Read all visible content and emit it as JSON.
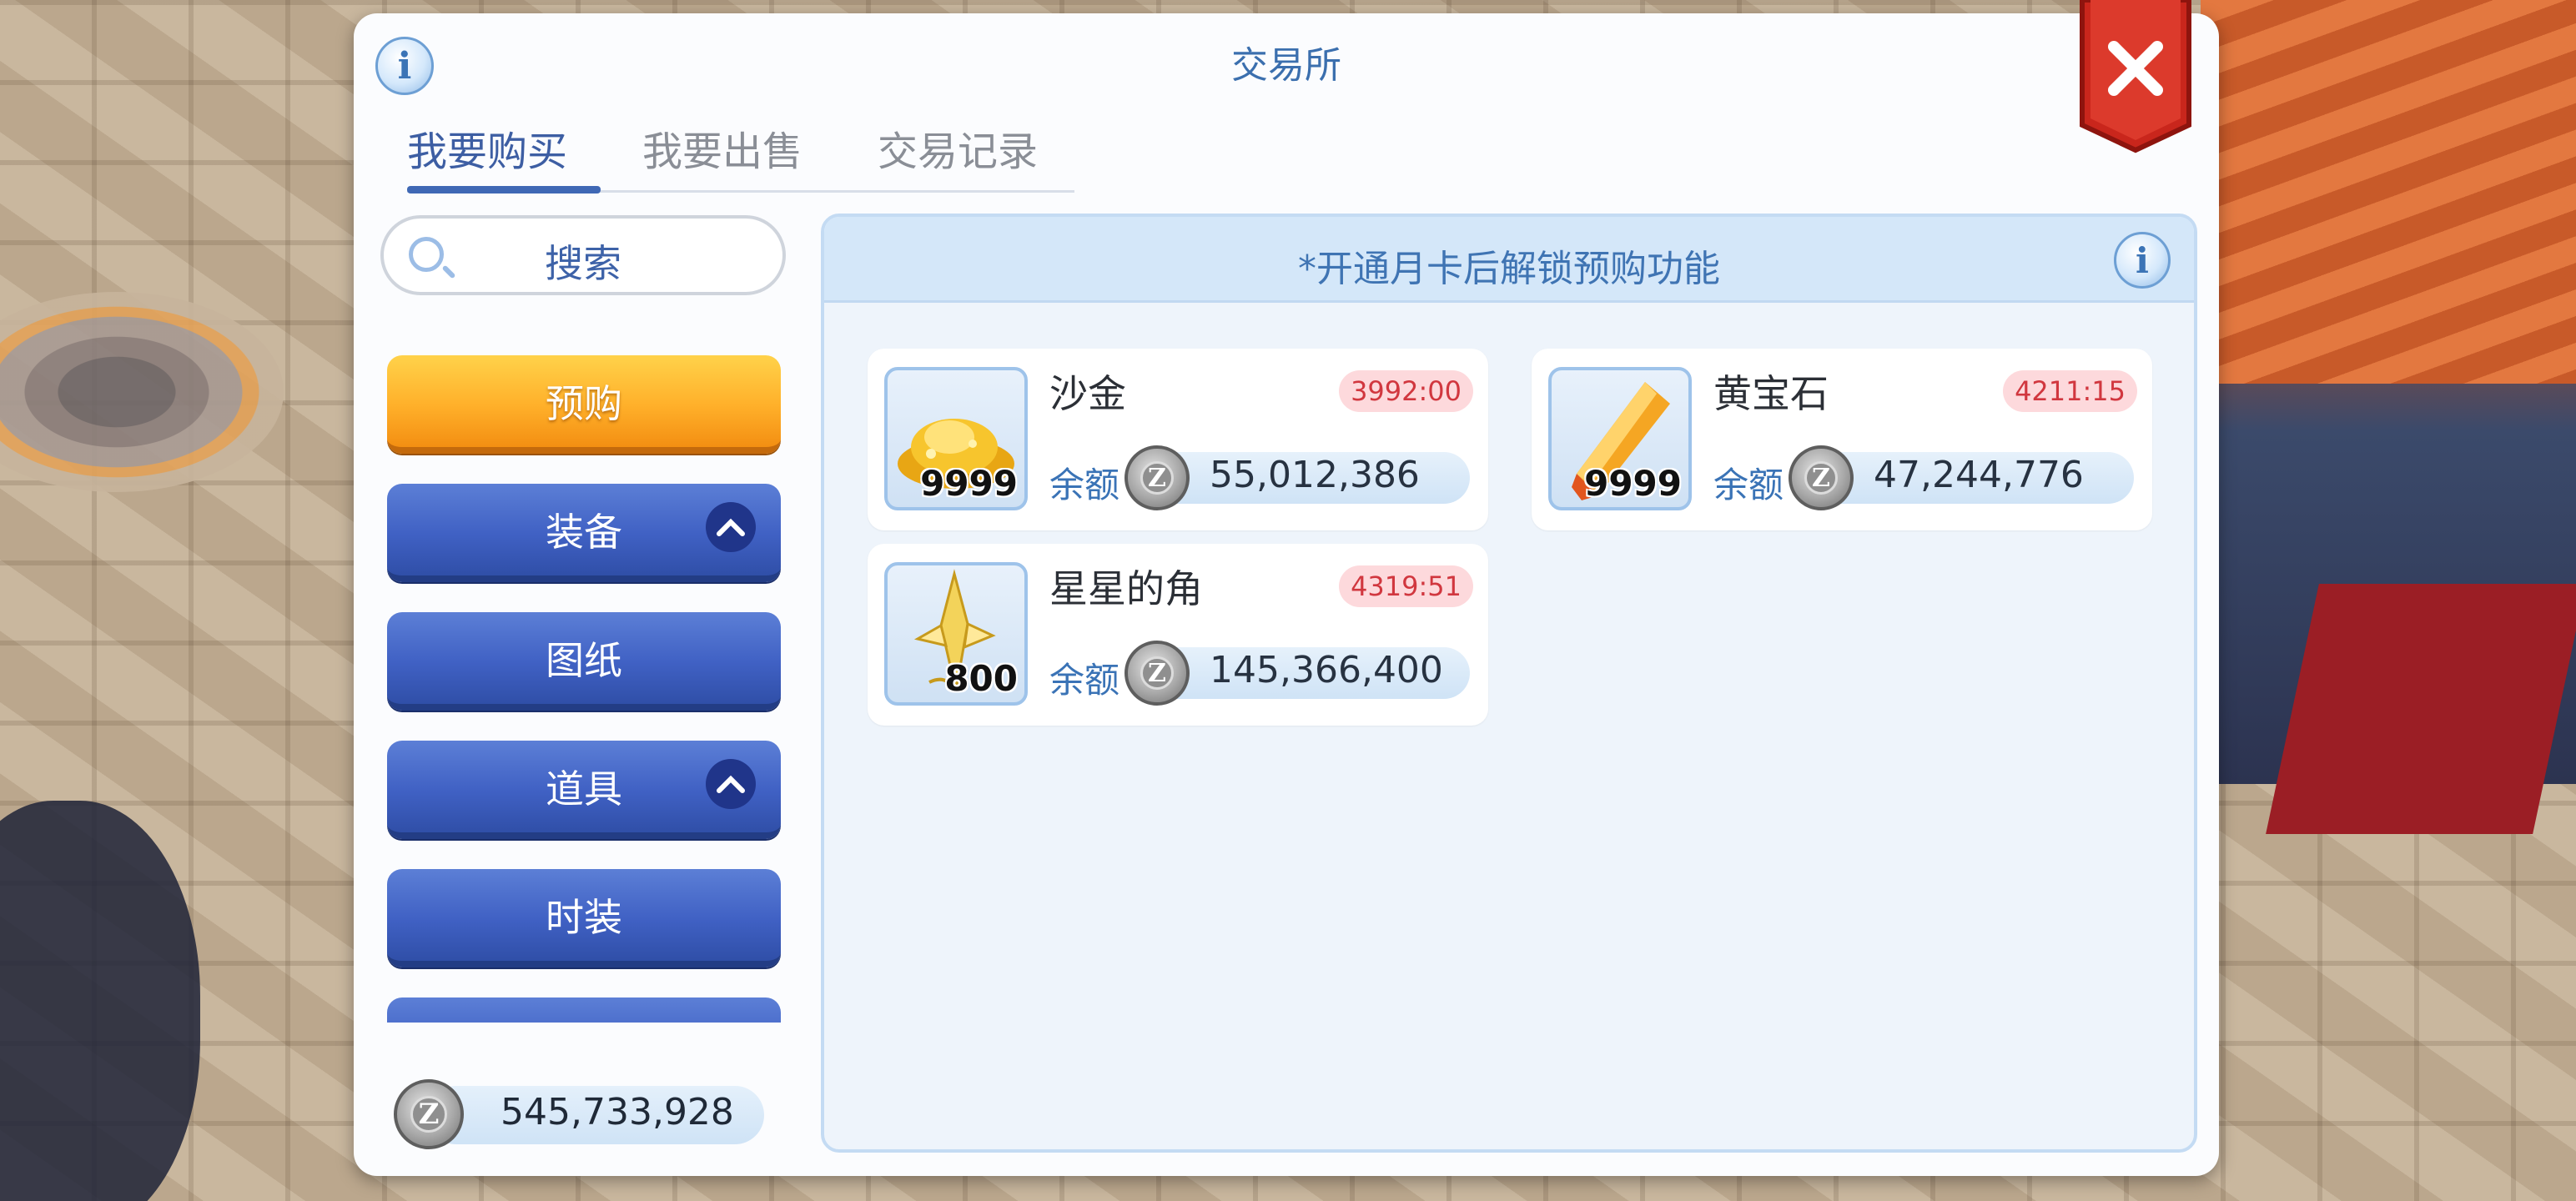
{
  "dialog": {
    "title": "交易所",
    "info_icon": "info-icon",
    "close_icon": "close-x-icon",
    "tabs": [
      {
        "label": "我要购买",
        "active": true
      },
      {
        "label": "我要出售",
        "active": false
      },
      {
        "label": "交易记录",
        "active": false
      }
    ]
  },
  "sidebar": {
    "search_label": "搜索",
    "categories": [
      {
        "label": "预购",
        "style": "orange",
        "expandable": false
      },
      {
        "label": "装备",
        "style": "blue",
        "expandable": true
      },
      {
        "label": "图纸",
        "style": "blue",
        "expandable": false
      },
      {
        "label": "道具",
        "style": "blue",
        "expandable": true
      },
      {
        "label": "时装",
        "style": "blue",
        "expandable": false
      }
    ],
    "wallet_balance": "545,733,928"
  },
  "panel": {
    "notice": "*开通月卡后解锁预购功能",
    "items": [
      {
        "name": "沙金",
        "quantity": "9999",
        "timer": "3992:00",
        "balance_label": "余额",
        "balance": "55,012,386",
        "icon": "sand-gold-icon"
      },
      {
        "name": "黄宝石",
        "quantity": "9999",
        "timer": "4211:15",
        "balance_label": "余额",
        "balance": "47,244,776",
        "icon": "topaz-icon"
      },
      {
        "name": "星星的角",
        "quantity": "800",
        "timer": "4319:51",
        "balance_label": "余额",
        "balance": "145,366,400",
        "icon": "star-horn-icon"
      }
    ]
  },
  "colors": {
    "accent_blue": "#3f68b5",
    "orange_button": "#ffb02a",
    "timer_red": "#d1373f",
    "close_red": "#c9261c"
  }
}
